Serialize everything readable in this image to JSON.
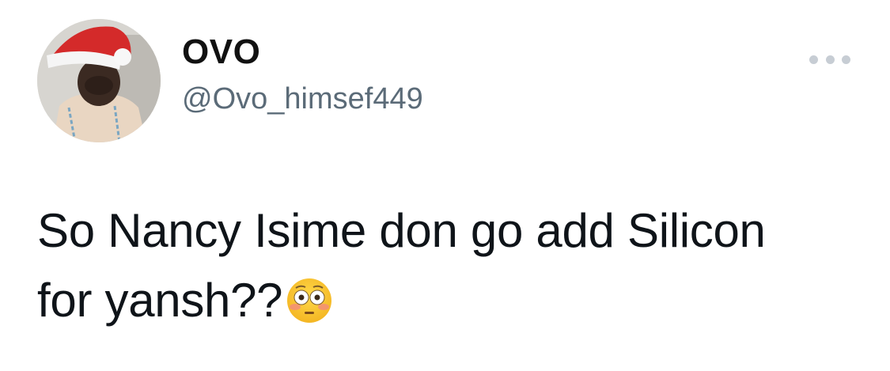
{
  "author": {
    "display_name": "OVO",
    "handle": "@Ovo_himsef449",
    "avatar_icon": "profile-photo-santa-hat"
  },
  "menu": {
    "more_icon": "more-dots-icon"
  },
  "tweet": {
    "text_line1": "So Nancy Isime don go add Silicon",
    "text_line2": "for yansh??",
    "emoji_icon": "flushed-face-emoji"
  },
  "colors": {
    "name": "#111111",
    "handle": "#5b6b78",
    "body": "#0f1419",
    "dots": "#c7cdd4",
    "background": "#ffffff"
  }
}
